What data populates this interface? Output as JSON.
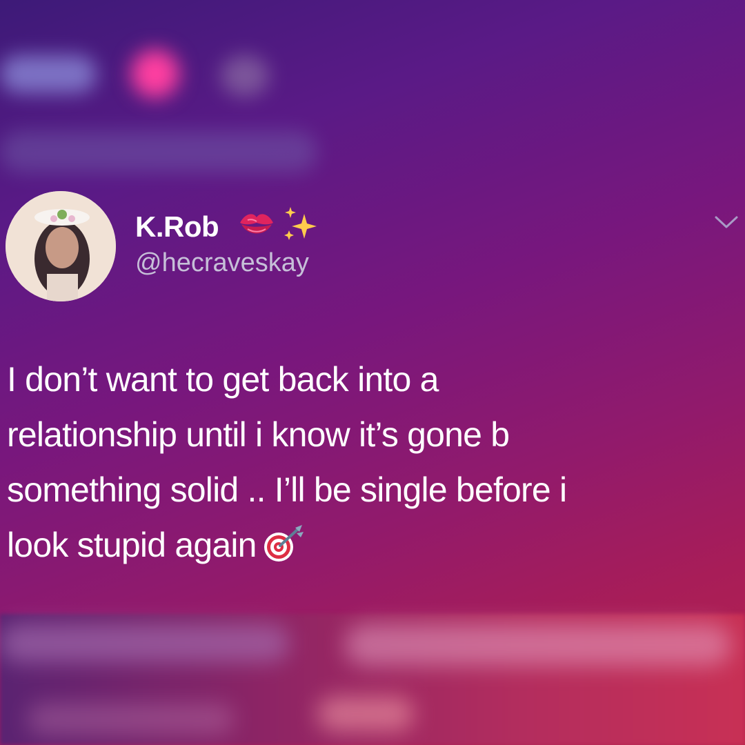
{
  "tweet": {
    "author_name": "K.Rob",
    "name_emojis": [
      "kiss-mark-icon",
      "sparkles-icon"
    ],
    "handle": "@hecraveskay",
    "text_lines": [
      "I don’t want to get back into a",
      "relationship until i know it’s gone b",
      "something solid .. I’ll be single before i",
      "look stupid again"
    ],
    "trailing_emoji": "direct-hit-icon"
  },
  "colors": {
    "background_top": "#3d1a78",
    "background_bottom": "#b8244c",
    "text": "#ffffff",
    "handle": "#c6bfd8"
  }
}
